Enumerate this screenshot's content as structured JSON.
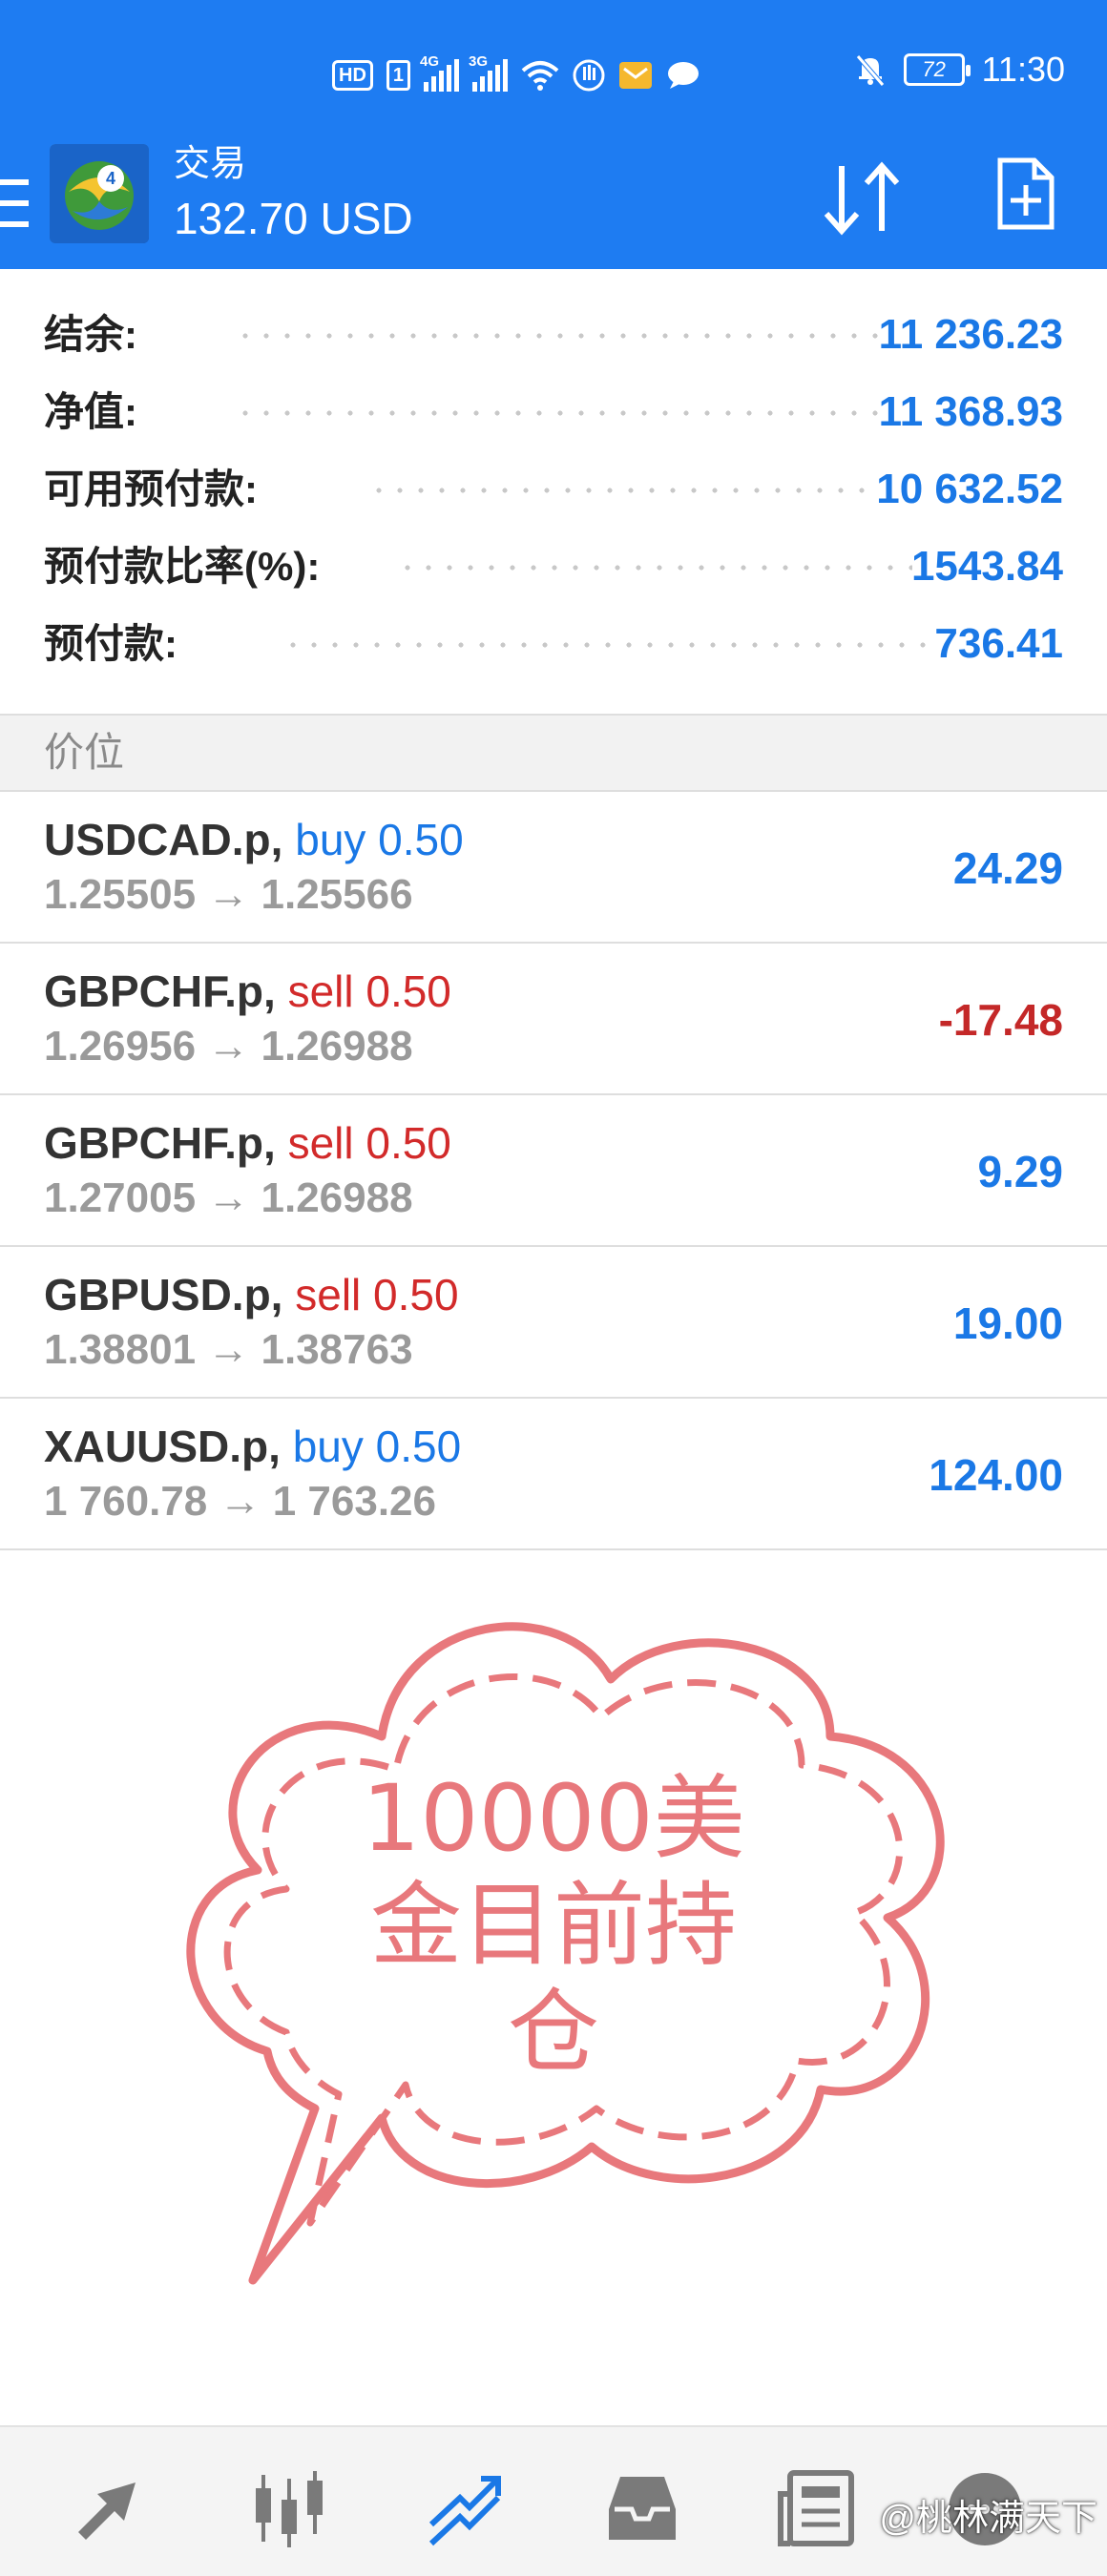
{
  "status_bar": {
    "hd_badge": "HD",
    "sim_badge": "1",
    "net1": "4G",
    "net2": "3G",
    "battery": "72",
    "time": "11:30"
  },
  "header": {
    "title": "交易",
    "balance": "132.70 USD"
  },
  "summary": [
    {
      "label": "结余:",
      "value": "11 236.23"
    },
    {
      "label": "净值:",
      "value": "11 368.93"
    },
    {
      "label": "可用预付款:",
      "value": "10 632.52"
    },
    {
      "label": "预付款比率(%):",
      "value": "1543.84"
    },
    {
      "label": "预付款:",
      "value": "736.41"
    }
  ],
  "section_title": "价位",
  "positions": [
    {
      "symbol": "USDCAD.p,",
      "side": "buy 0.50",
      "prices": "1.25505 → 1.25566",
      "profit": "24.29"
    },
    {
      "symbol": "GBPCHF.p,",
      "side": "sell 0.50",
      "prices": "1.26956 → 1.26988",
      "profit": "-17.48"
    },
    {
      "symbol": "GBPCHF.p,",
      "side": "sell 0.50",
      "prices": "1.27005 → 1.26988",
      "profit": "9.29"
    },
    {
      "symbol": "GBPUSD.p,",
      "side": "sell 0.50",
      "prices": "1.38801 → 1.38763",
      "profit": "19.00"
    },
    {
      "symbol": "XAUUSD.p,",
      "side": "buy 0.50",
      "prices": "1 760.78 → 1 763.26",
      "profit": "124.00"
    }
  ],
  "bubble": {
    "line1": "10000美",
    "line2": "金目前持",
    "line3": "仓",
    "color": "#e8787c"
  },
  "bottom_nav": [
    "quotes-icon",
    "chart-icon",
    "trade-icon",
    "history-icon",
    "news-icon",
    "chat-icon"
  ],
  "watermark": "@桃林满天下",
  "colors": {
    "brand": "#1e7cf2",
    "positive": "#1a78e6",
    "negative": "#c42828"
  }
}
